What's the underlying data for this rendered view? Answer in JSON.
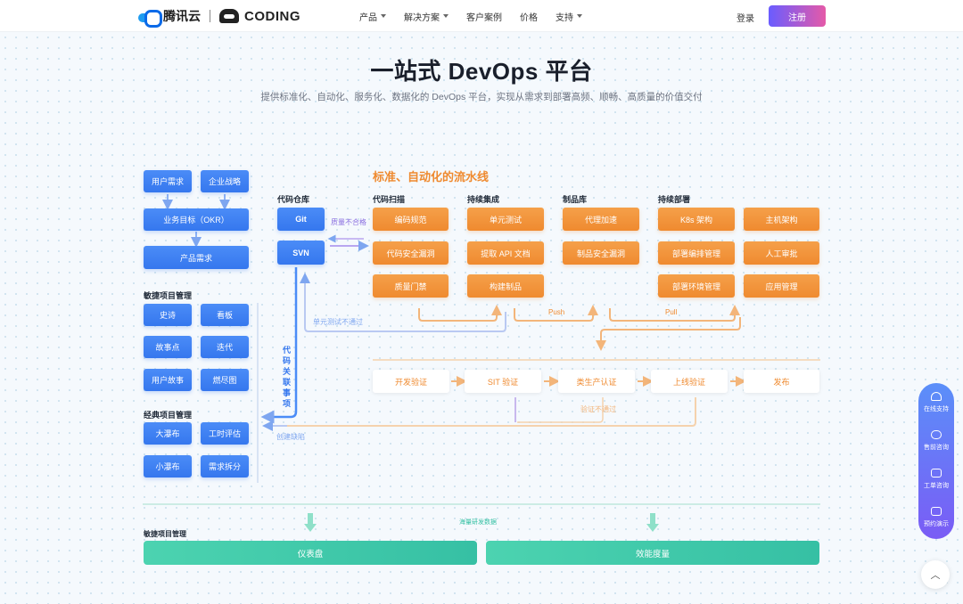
{
  "nav": {
    "logo_tencent": "腾讯云",
    "logo_coding": "CODING",
    "menu": [
      {
        "label": "产品",
        "dropdown": true
      },
      {
        "label": "解决方案",
        "dropdown": true
      },
      {
        "label": "客户案例",
        "dropdown": false
      },
      {
        "label": "价格",
        "dropdown": false
      },
      {
        "label": "支持",
        "dropdown": true
      }
    ],
    "login": "登录",
    "register": "注册"
  },
  "hero": {
    "title": "一站式 DevOps 平台",
    "subtitle": "提供标准化、自动化、服务化、数据化的 DevOps 平台，实现从需求到部署高频、顺畅、高质量的价值交付"
  },
  "planning": {
    "user_demand": "用户需求",
    "enterprise_strategy": "企业战略",
    "business_goal": "业务目标（OKR）",
    "product_demand": "产品需求",
    "agile_title": "敏捷项目管理",
    "agile_items": [
      "史诗",
      "看板",
      "故事点",
      "迭代",
      "用户故事",
      "燃尽图"
    ],
    "classic_title": "经典项目管理",
    "classic_items": [
      "大瀑布",
      "工时评估",
      "小瀑布",
      "需求拆分"
    ]
  },
  "repo": {
    "title": "代码仓库",
    "git": "Git",
    "svn": "SVN",
    "quality_fail": "质量不合格",
    "unit_fail": "单元测试不通过",
    "code_link": "代码关联事项",
    "create_defect": "创建缺陷"
  },
  "pipeline": {
    "title": "标准、自动化的流水线",
    "columns": {
      "scan": "代码扫描",
      "ci": "持续集成",
      "artifact": "制品库",
      "cd": "持续部署"
    },
    "scan_items": [
      "编码规范",
      "代码安全漏洞",
      "质量门禁"
    ],
    "ci_items": [
      "单元测试",
      "提取 API 文档",
      "构建制品"
    ],
    "artifact_items": [
      "代理加速",
      "制品安全漏洞"
    ],
    "cd_items": [
      "K8s 架构",
      "主机架构",
      "部署编排管理",
      "人工审批",
      "部署环境管理",
      "应用管理"
    ],
    "push": "Push",
    "pull": "Pull"
  },
  "release": {
    "stages": [
      "开发验证",
      "SIT 验证",
      "类生产认证",
      "上线验证",
      "发布"
    ],
    "verify_fail": "验证不通过"
  },
  "bottom": {
    "title": "敏捷项目管理",
    "mass_data": "海量研发数据",
    "dashboard": "仪表盘",
    "metrics": "效能度量"
  },
  "side_widget": {
    "items": [
      "在线支持",
      "售前咨询",
      "工单咨询",
      "预约演示"
    ]
  },
  "colors": {
    "primary_blue": "#3577ee",
    "pipeline_orange": "#ef8a2f",
    "metrics_green": "#36c0a4",
    "register_gradient_start": "#6a5cff",
    "register_gradient_end": "#e55aa8"
  }
}
